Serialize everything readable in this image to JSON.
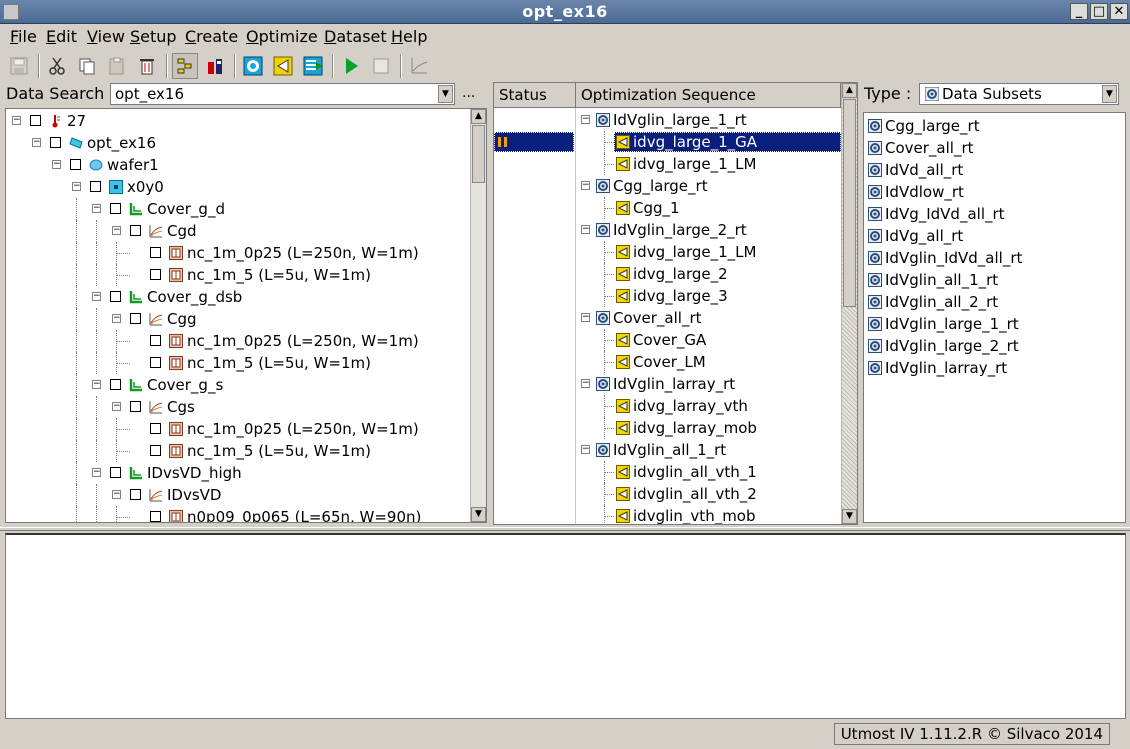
{
  "window": {
    "title": "opt_ex16"
  },
  "menu": [
    "File",
    "Edit",
    "View",
    "Setup",
    "Create",
    "Optimize",
    "Dataset",
    "Help"
  ],
  "toolbar_icons": [
    "save-icon",
    "cut-icon",
    "copy-icon",
    "paste-icon",
    "delete-icon",
    "sequence-icon",
    "model-icon",
    "target-icon",
    "arrow-icon",
    "dataset-icon",
    "run-icon",
    "stop-icon",
    "plot-icon"
  ],
  "search": {
    "label": "Data Search :",
    "value": "opt_ex16",
    "more": "..."
  },
  "tree": [
    {
      "text": "27",
      "icon": "thermometer",
      "level": 0
    },
    {
      "text": "opt_ex16",
      "icon": "project",
      "level": 1
    },
    {
      "text": "wafer1",
      "icon": "wafer",
      "level": 2
    },
    {
      "text": "x0y0",
      "icon": "die",
      "level": 3
    },
    {
      "text": "Cover_g_d",
      "icon": "group",
      "level": 4
    },
    {
      "text": "Cgd",
      "icon": "curve",
      "level": 5
    },
    {
      "text": "nc_1m_0p25 (L=250n, W=1m)",
      "icon": "device",
      "level": 6
    },
    {
      "text": "nc_1m_5 (L=5u, W=1m)",
      "icon": "device",
      "level": 6
    },
    {
      "text": "Cover_g_dsb",
      "icon": "group",
      "level": 4
    },
    {
      "text": "Cgg",
      "icon": "curve",
      "level": 5
    },
    {
      "text": "nc_1m_0p25 (L=250n, W=1m)",
      "icon": "device",
      "level": 6
    },
    {
      "text": "nc_1m_5 (L=5u, W=1m)",
      "icon": "device",
      "level": 6
    },
    {
      "text": "Cover_g_s",
      "icon": "group",
      "level": 4
    },
    {
      "text": "Cgs",
      "icon": "curve",
      "level": 5
    },
    {
      "text": "nc_1m_0p25 (L=250n, W=1m)",
      "icon": "device",
      "level": 6
    },
    {
      "text": "nc_1m_5 (L=5u, W=1m)",
      "icon": "device",
      "level": 6
    },
    {
      "text": "IDvsVD_high",
      "icon": "group",
      "level": 4
    },
    {
      "text": "IDvsVD",
      "icon": "curve",
      "level": 5
    },
    {
      "text": "n0p09_0p065 (L=65n, W=90n)",
      "icon": "device",
      "level": 6
    }
  ],
  "sequence": {
    "status_header": "Status",
    "seq_header": "Optimization Sequence",
    "items": [
      {
        "text": "IdVglin_large_1_rt",
        "type": "group"
      },
      {
        "text": "idvg_large_1_GA",
        "type": "step",
        "selected": true,
        "status": "paused"
      },
      {
        "text": "idvg_large_1_LM",
        "type": "step"
      },
      {
        "text": "Cgg_large_rt",
        "type": "group"
      },
      {
        "text": "Cgg_1",
        "type": "step"
      },
      {
        "text": "IdVglin_large_2_rt",
        "type": "group"
      },
      {
        "text": "idvg_large_1_LM",
        "type": "step"
      },
      {
        "text": "idvg_large_2",
        "type": "step"
      },
      {
        "text": "idvg_large_3",
        "type": "step"
      },
      {
        "text": "Cover_all_rt",
        "type": "group"
      },
      {
        "text": "Cover_GA",
        "type": "step"
      },
      {
        "text": "Cover_LM",
        "type": "step"
      },
      {
        "text": "IdVglin_larray_rt",
        "type": "group"
      },
      {
        "text": "idvg_larray_vth",
        "type": "step"
      },
      {
        "text": "idvg_larray_mob",
        "type": "step"
      },
      {
        "text": "IdVglin_all_1_rt",
        "type": "group"
      },
      {
        "text": "idvglin_all_vth_1",
        "type": "step"
      },
      {
        "text": "idvglin_all_vth_2",
        "type": "step"
      },
      {
        "text": "idvglin_vth_mob",
        "type": "step"
      }
    ]
  },
  "type_select": {
    "label": "Type :",
    "value": "Data Subsets"
  },
  "subsets": [
    "Cgg_large_rt",
    "Cover_all_rt",
    "IdVd_all_rt",
    "IdVdlow_rt",
    "IdVg_IdVd_all_rt",
    "IdVg_all_rt",
    "IdVglin_IdVd_all_rt",
    "IdVglin_all_1_rt",
    "IdVglin_all_2_rt",
    "IdVglin_large_1_rt",
    "IdVglin_large_2_rt",
    "IdVglin_larray_rt"
  ],
  "status_bar": "Utmost IV 1.11.2.R © Silvaco 2014"
}
